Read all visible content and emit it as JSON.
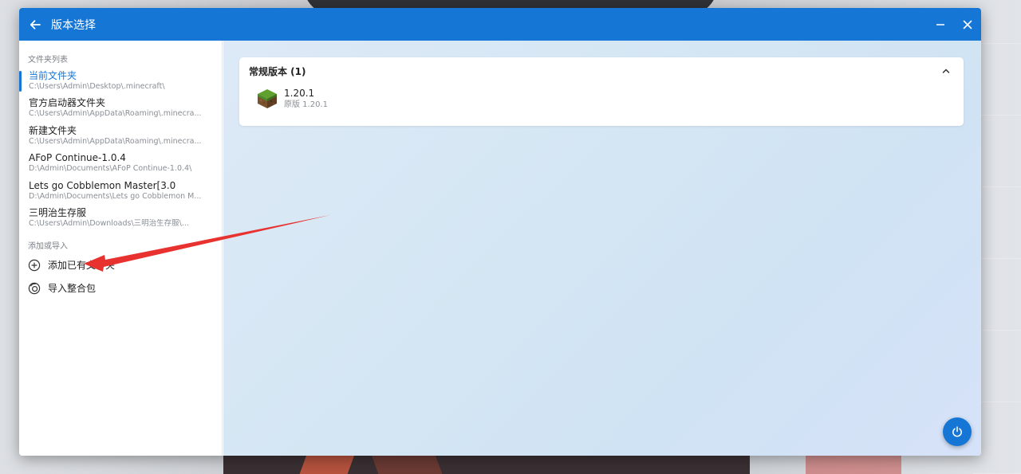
{
  "window": {
    "title": "版本选择",
    "back_icon": "arrow-left-icon",
    "minimize_icon": "minimize-icon",
    "close_icon": "close-icon",
    "accent_color": "#1676d6"
  },
  "sidebar": {
    "folders_label": "文件夹列表",
    "folders": [
      {
        "name": "当前文件夹",
        "path": "C:\\Users\\Admin\\Desktop\\.minecraft\\",
        "active": true
      },
      {
        "name": "官方启动器文件夹",
        "path": "C:\\Users\\Admin\\AppData\\Roaming\\.minecra..."
      },
      {
        "name": "新建文件夹",
        "path": "C:\\Users\\Admin\\AppData\\Roaming\\.minecra..."
      },
      {
        "name": "AFoP Continue-1.0.4",
        "path": "D:\\Admin\\Documents\\AFoP Continue-1.0.4\\"
      },
      {
        "name": "Lets go Cobblemon Master[3.0",
        "path": "D:\\Admin\\Documents\\Lets go Cobblemon M..."
      },
      {
        "name": "三明治生存服",
        "path": "C:\\Users\\Admin\\Downloads\\三明治生存服\\..."
      }
    ],
    "actions_label": "添加或导入",
    "actions": [
      {
        "label": "添加已有文件夹",
        "icon": "plus-circle-icon"
      },
      {
        "label": "导入整合包",
        "icon": "import-package-icon"
      }
    ]
  },
  "main": {
    "group_title": "常规版本 (1)",
    "collapse_icon": "chevron-up-icon",
    "versions": [
      {
        "name": "1.20.1",
        "sub": "原版 1.20.1",
        "icon": "grass-block-icon"
      }
    ],
    "power_icon": "power-icon"
  }
}
